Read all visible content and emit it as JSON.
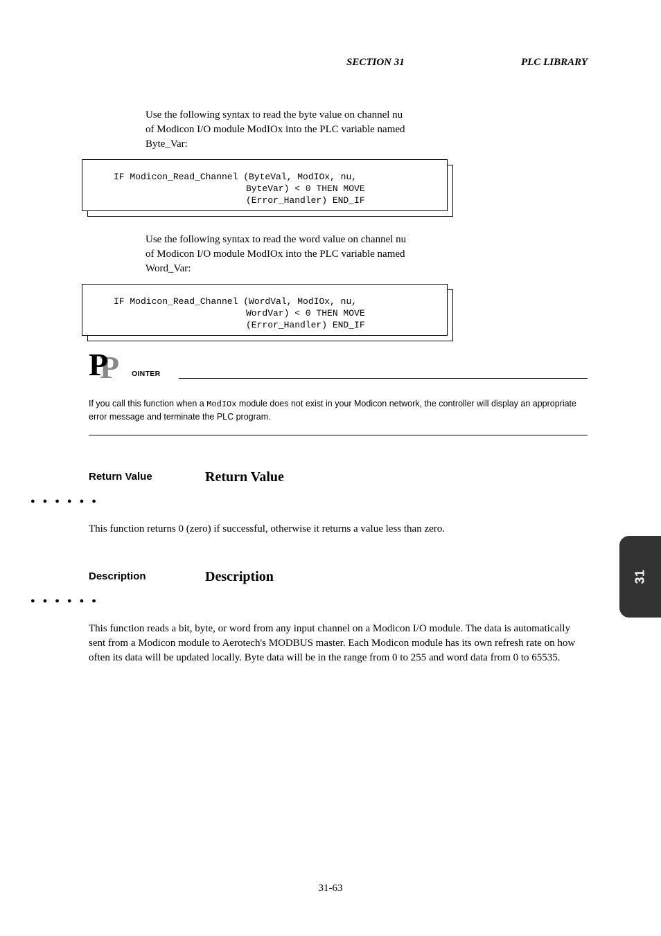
{
  "header": {
    "section": "SECTION 31",
    "right": "PLC LIBRARY"
  },
  "topList": {
    "line1": "Use the following syntax to read the byte value on channel nu",
    "line2": "of Modicon I/O module ModIOx into the PLC variable named",
    "line3": "Byte_Var:"
  },
  "codeBox1": {
    "l1": "IF Modicon_Read_Channel (ByteVal, ModIOx, nu,",
    "l2": "ByteVar) < 0 THEN MOVE",
    "l3": "(Error_Handler) END_IF"
  },
  "midList": {
    "line1": "Use the following syntax to read the word value on channel nu",
    "line2": "of Modicon I/O module ModIOx into the PLC variable named",
    "line3": "Word_Var:"
  },
  "codeBox2": {
    "l1": "IF Modicon_Read_Channel (WordVal, ModIOx, nu,",
    "l2": "WordVar) < 0 THEN MOVE",
    "l3": "(Error_Handler) END_IF"
  },
  "pointer": {
    "label": "OINTER",
    "bodyPrefix": "If you call this function when a ",
    "bodyMono": "ModIOx",
    "bodySuffix": " module does not exist in your Modicon network, the controller will display an appropriate error message and terminate the PLC program."
  },
  "returnSection": {
    "label": "Return Value",
    "heading": "Return Value",
    "body": "This function returns 0 (zero) if successful, otherwise it returns a value less than zero."
  },
  "descSection": {
    "label": "Description",
    "heading": "Description",
    "body": "This function reads a bit, byte, or word from any input channel on a Modicon I/O module. The data is automatically sent from a Modicon module to Aerotech's MODBUS master. Each Modicon module has its own refresh rate on how often its data will be updated locally. Byte data will be in the range from 0 to 255 and word data from 0 to 65535."
  },
  "tab": "31",
  "pageNumber": "31-63"
}
